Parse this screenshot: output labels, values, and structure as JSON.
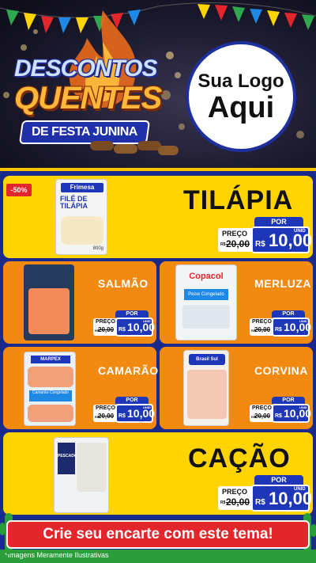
{
  "header": {
    "title_line1": "DESCONTOS",
    "title_line2": "QUENTES",
    "subtitle": "DE FESTA JUNINA",
    "logo_line1": "Sua Logo",
    "logo_line2": "Aqui"
  },
  "featured_top": {
    "name": "TILÁPIA",
    "discount_badge": "-50%",
    "package_brand": "Frimesa",
    "package_text": "FILÉ DE TILÁPIA",
    "package_weight": "800g",
    "price": {
      "por": "POR",
      "preco": "PREÇO",
      "old_currency": "R$",
      "old": "20,00",
      "currency": "R$",
      "value": "10,00",
      "unit": "UNID"
    }
  },
  "grid": [
    {
      "name": "SALMÃO",
      "price": {
        "por": "POR",
        "preco": "PREÇO",
        "old_currency": "R$",
        "old": "20,00",
        "currency": "R$",
        "value": "10,00",
        "unit": "UNID"
      }
    },
    {
      "name": "MERLUZA",
      "package_brand": "Copacol",
      "package_text": "Peixe Congelado",
      "price": {
        "por": "POR",
        "preco": "PREÇO",
        "old_currency": "R$",
        "old": "20,00",
        "currency": "R$",
        "value": "10,00",
        "unit": "UNID"
      }
    },
    {
      "name": "CAMARÃO",
      "package_brand": "MARPEX",
      "package_text": "Camarão Congelado",
      "price": {
        "por": "POR",
        "preco": "PREÇO",
        "old_currency": "R$",
        "old": "20,00",
        "currency": "R$",
        "value": "10,00",
        "unit": "UNID"
      }
    },
    {
      "name": "CORVINA",
      "package_brand": "Brasil Sul",
      "price": {
        "por": "POR",
        "preco": "PREÇO",
        "old_currency": "R$",
        "old": "20,00",
        "currency": "R$",
        "value": "10,00",
        "unit": "UNID"
      }
    }
  ],
  "featured_bottom": {
    "name": "CAÇÃO",
    "package_text": "PESCADOS",
    "price": {
      "por": "POR",
      "preco": "PREÇO",
      "old_currency": "R$",
      "old": "20,00",
      "currency": "R$",
      "value": "10,00",
      "unit": "UNID"
    }
  },
  "cta": "Crie seu encarte com este tema!",
  "footer_note": "*Imagens Meramente Ilustrativas",
  "colors": {
    "blue": "#1e36b8",
    "yellow": "#ffd400",
    "orange": "#f28a12",
    "red": "#e3262b",
    "navy_bg": "#1a2a8c"
  }
}
